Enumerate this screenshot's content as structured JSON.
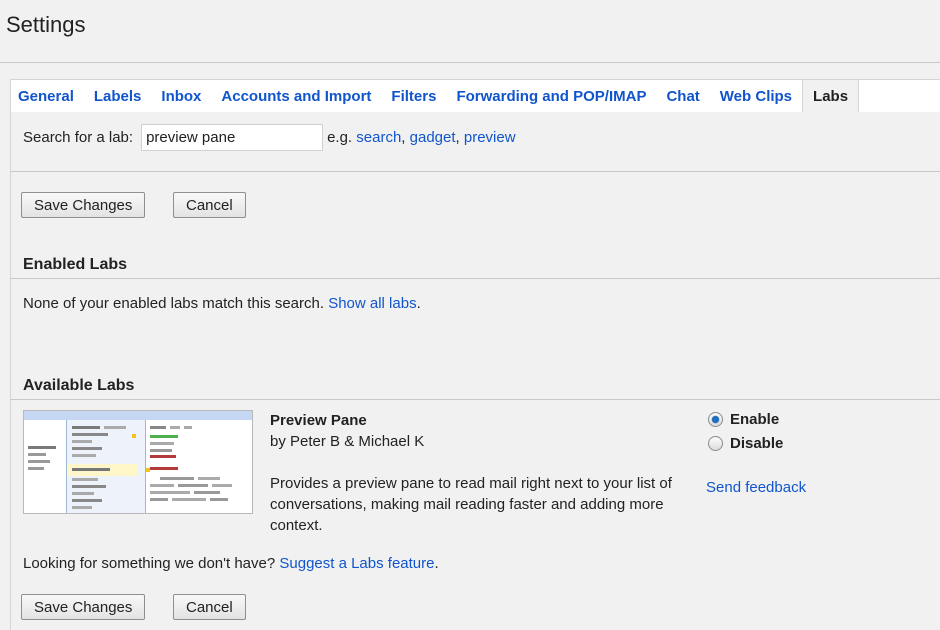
{
  "header": {
    "title": "Settings"
  },
  "tabs": [
    {
      "label": "General",
      "active": false
    },
    {
      "label": "Labels",
      "active": false
    },
    {
      "label": "Inbox",
      "active": false
    },
    {
      "label": "Accounts and Import",
      "active": false
    },
    {
      "label": "Filters",
      "active": false
    },
    {
      "label": "Forwarding and POP/IMAP",
      "active": false
    },
    {
      "label": "Chat",
      "active": false
    },
    {
      "label": "Web Clips",
      "active": false
    },
    {
      "label": "Labs",
      "active": true
    }
  ],
  "search": {
    "label": "Search for a lab:",
    "value": "preview pane",
    "eg_prefix": "e.g.",
    "examples": [
      "search",
      "gadget",
      "preview"
    ],
    "separator": ","
  },
  "buttons": {
    "save": "Save Changes",
    "cancel": "Cancel"
  },
  "enabled_labs": {
    "heading": "Enabled Labs",
    "message": "None of your enabled labs match this search.",
    "show_all_link": "Show all labs",
    "trailing": "."
  },
  "available_labs": {
    "heading": "Available Labs",
    "items": [
      {
        "name": "Preview Pane",
        "author": "by Peter B & Michael K",
        "description": "Provides a preview pane to read mail right next to your list of conversations, making mail reading faster and adding more context.",
        "options": [
          {
            "label": "Enable",
            "checked": true
          },
          {
            "label": "Disable",
            "checked": false
          }
        ],
        "feedback_link": "Send feedback"
      }
    ]
  },
  "suggest": {
    "prefix": "Looking for something we don't have?",
    "link": "Suggest a Labs feature",
    "trailing": "."
  },
  "colors": {
    "link": "#1155cc",
    "background": "#f1f1f1",
    "radio_accent": "#1e6fc1"
  }
}
